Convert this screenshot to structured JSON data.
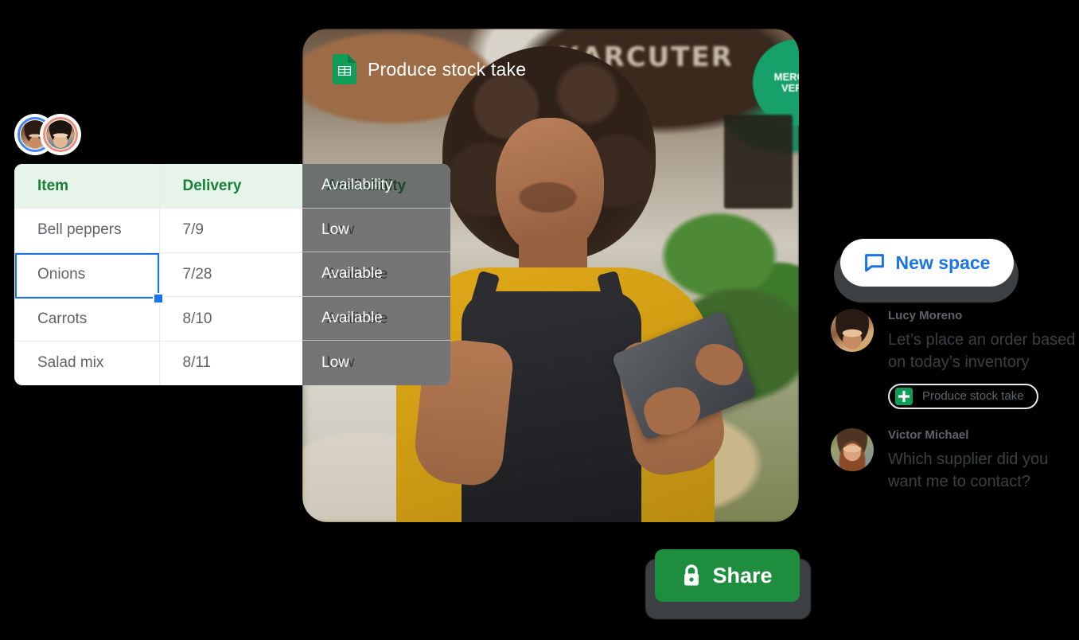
{
  "collaborators": {
    "label": "active-collaborators",
    "avatars": [
      {
        "name": "collaborator-1",
        "ring_color": "#4285f4"
      },
      {
        "name": "collaborator-2",
        "ring_color": "#ea8f7e"
      }
    ]
  },
  "spreadsheet": {
    "doc_title": "Produce stock take",
    "doc_icon": "google-sheets-icon",
    "header_bg": "#e6f4ea",
    "header_text_color": "#188038",
    "selection_color": "#1a73e8",
    "selected_cell": "Onions",
    "columns": [
      "Item",
      "Delivery",
      "Availability"
    ],
    "rows": [
      {
        "item": "Bell peppers",
        "delivery": "7/9",
        "availability": "Low"
      },
      {
        "item": "Onions",
        "delivery": "7/28",
        "availability": "Available"
      },
      {
        "item": "Carrots",
        "delivery": "8/10",
        "availability": "Available"
      },
      {
        "item": "Salad mix",
        "delivery": "8/11",
        "availability": "Low"
      }
    ]
  },
  "photo": {
    "alt": "grocer-checking-inventory-on-tablet",
    "signage_text": "XARCUTER",
    "badge_line1": "MERCAT",
    "badge_line2": "VERD"
  },
  "share": {
    "label": "Share",
    "icon": "lock-icon",
    "color": "#1e8e3e"
  },
  "chat": {
    "new_space": {
      "label": "New space",
      "icon": "chat-bubble-icon",
      "color": "#1a73e8"
    },
    "messages": [
      {
        "sender": "Lucy Moreno",
        "text": "Let’s place an order based on today’s inventory",
        "attachment": {
          "label": "Produce stock take",
          "icon": "google-sheets-icon"
        }
      },
      {
        "sender": "Victor Michael",
        "text": "Which supplier did you want me to contact?",
        "attachment": null
      }
    ]
  }
}
